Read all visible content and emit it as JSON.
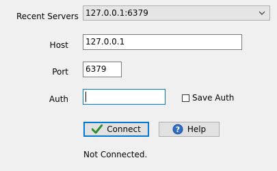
{
  "recent_servers": {
    "label": "Recent Servers",
    "selected": "127.0.0.1:6379"
  },
  "host": {
    "label": "Host",
    "value": "127.0.0.1"
  },
  "port": {
    "label": "Port",
    "value": "6379"
  },
  "auth": {
    "label": "Auth",
    "value": "",
    "save_auth_label": "Save Auth",
    "save_auth_checked": false
  },
  "buttons": {
    "connect": "Connect",
    "help": "Help"
  },
  "status": "Not Connected.",
  "colors": {
    "background": "#f0f0f0",
    "focus_border": "#0078d7",
    "check_icon": "#2e8b2e",
    "help_icon": "#2f6ec7"
  }
}
